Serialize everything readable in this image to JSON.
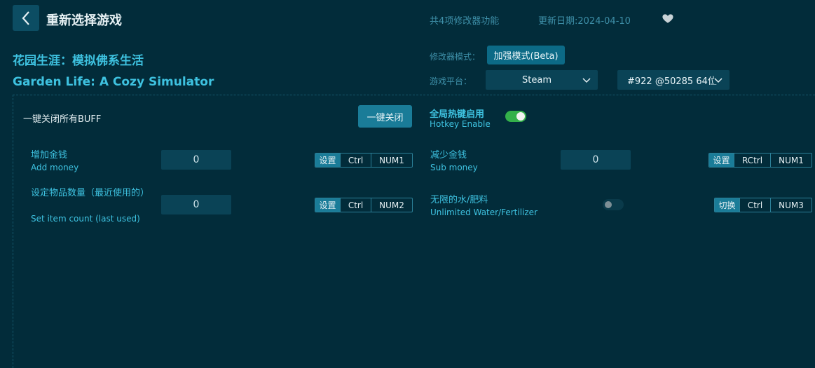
{
  "header": {
    "title": "重新选择游戏",
    "feature_count": "共4项修改器功能",
    "update_date": "更新日期:2024-04-10"
  },
  "game": {
    "name_cn": "花园生涯：模拟佛系生活",
    "name_en": "Garden Life: A Cozy Simulator"
  },
  "mode": {
    "label": "修改器模式：",
    "value": "加强模式(Beta)"
  },
  "platform": {
    "label": "游戏平台：",
    "value": "Steam",
    "version": "#922 @50285 64位"
  },
  "global": {
    "off_all_label": "一键关闭所有BUFF",
    "off_all_button": "一键关闭",
    "hotkey_cn": "全局热键启用",
    "hotkey_en": "Hotkey Enable",
    "hotkey_enabled": true
  },
  "options": {
    "add_money": {
      "cn": "增加金钱",
      "en": "Add money",
      "value": "0",
      "action": "设置",
      "mod": "Ctrl",
      "key": "NUM1"
    },
    "sub_money": {
      "cn": "减少金钱",
      "en": "Sub money",
      "value": "0",
      "action": "设置",
      "mod": "RCtrl",
      "key": "NUM1"
    },
    "set_item": {
      "cn": "设定物品数量（最近使用的）",
      "en": "Set item count (last used)",
      "value": "0",
      "action": "设置",
      "mod": "Ctrl",
      "key": "NUM2"
    },
    "unlimited_water": {
      "cn": "无限的水/肥料",
      "en": "Unlimited Water/Fertilizer",
      "enabled": false,
      "action": "切换",
      "mod": "Ctrl",
      "key": "NUM3"
    }
  },
  "colors": {
    "background": "#022c3a",
    "accent": "#3ec2e0",
    "button": "#1a7c98",
    "toggle_on": "#33b04a"
  }
}
